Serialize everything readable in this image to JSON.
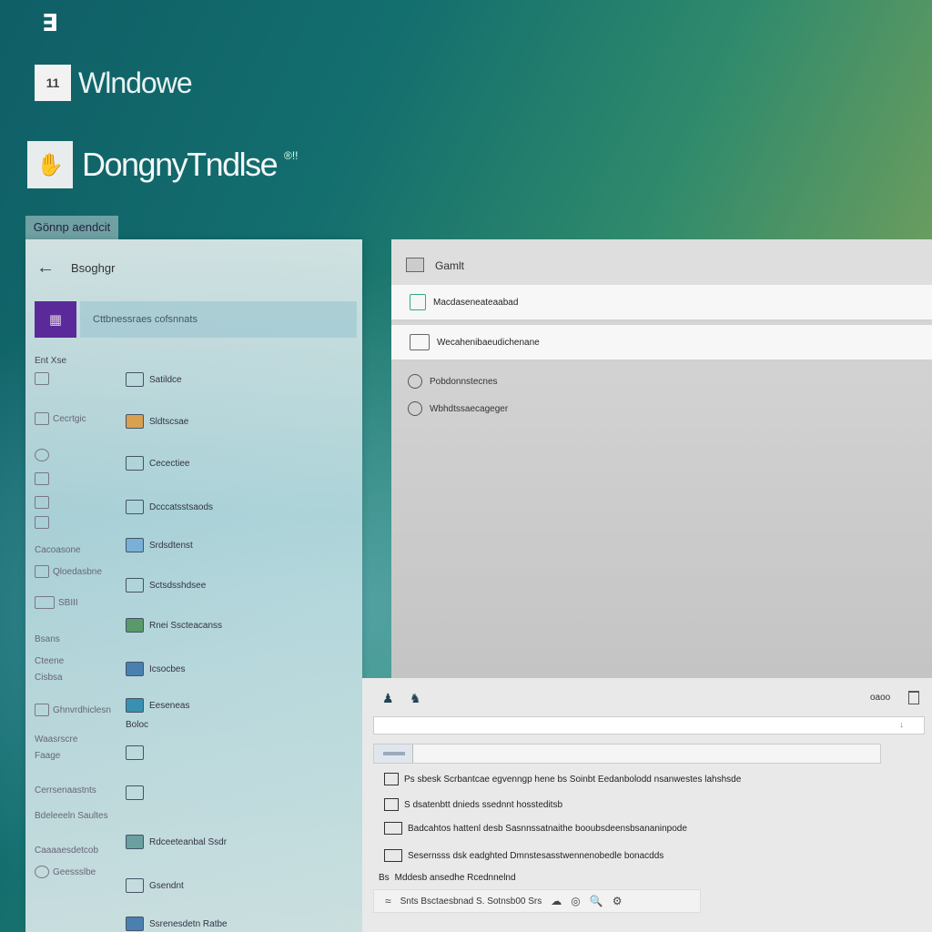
{
  "branding": {
    "top_logo": "∃",
    "windows_tile": "11",
    "windows_text": "Wlndowe",
    "app_text": "DongnyTndlse",
    "app_superscript": "®!!",
    "tab_chip": "Gönnp aendcit"
  },
  "left_panel": {
    "back_icon": "←",
    "title": "Bsoghgr",
    "avatar_text": "▦",
    "search_text": "Cttbnessraes cofsnnats",
    "category": "Ent Xse",
    "side_items": [
      {
        "label": "",
        "icon": "doc-icon"
      },
      {
        "label": "Cecrtgic",
        "icon": "tablet-icon"
      },
      {
        "label": "",
        "icon": "globe-icon"
      },
      {
        "label": "",
        "icon": "device-icon"
      },
      {
        "label": "",
        "icon": "monitor-icon"
      },
      {
        "label": "",
        "icon": "grid-icon"
      },
      {
        "label": "Cacoasone",
        "icon": ""
      },
      {
        "label": "Qloedasbne",
        "icon": "printer-icon"
      },
      {
        "label": "SBIII",
        "icon": "window-icon"
      },
      {
        "label": "Bsans",
        "icon": ""
      },
      {
        "label": "Cteene",
        "icon": ""
      },
      {
        "label": "Cisbsa",
        "icon": ""
      },
      {
        "label": "Ghnvrdhiclesn",
        "icon": "share-icon"
      },
      {
        "label": "Waasrscre",
        "icon": ""
      },
      {
        "label": "Faage",
        "icon": ""
      },
      {
        "label": "Cerrsenaastnts",
        "icon": ""
      },
      {
        "label": "Bdeleeeln Saultes",
        "icon": ""
      },
      {
        "label": "Caaaaesdetcob",
        "icon": ""
      },
      {
        "label": "Geessslbe",
        "icon": "gear-icon"
      }
    ],
    "main_items": [
      "Satildce",
      "Sldtscsae",
      "Cecectiee",
      "Dcccatsstsaods",
      "Srdsdtenst",
      "Sctsdsshdsee",
      "Rnei Sscteacanss",
      "Icsocbes",
      "Eeseneas",
      "",
      "",
      "Rdceeteanbal Ssdr",
      "Gsendnt",
      "Ssrenesdetn Ratbe"
    ],
    "sub_label": "Boloc"
  },
  "right_panel": {
    "header_title": "Gamlt",
    "rows": [
      "Macdaseneateaabad",
      "Wecahenibaeudichenane"
    ],
    "plain_items": [
      "Pobdonnstecnes",
      "Wbhdtssaecageger"
    ]
  },
  "bottom_panel": {
    "right_label": "oaoo",
    "input_icon": "↓",
    "lines": [
      "Ps sbesk Scrbantcae egvenngp hene bs Soinbt Eedanbolodd nsanwestes lahshsde",
      "S dsatenbtt dnieds ssednnt hossteditsb",
      "Badcahtos hattenl desb Sasnnssatnaithe booubsdeensbsananinpode",
      "Sesernsss dsk eadghted Dmnstesasstwennenobedle bonacdds",
      "Mddesb ansedhe Rcednnelnd"
    ],
    "line_prefix_5": "Bs",
    "footer_text": "Snts Bsctaesbnad S. Sotnsb00 Srs",
    "footer_icons": [
      "≈",
      "☁",
      "◎",
      "🔍",
      "⚙"
    ]
  }
}
